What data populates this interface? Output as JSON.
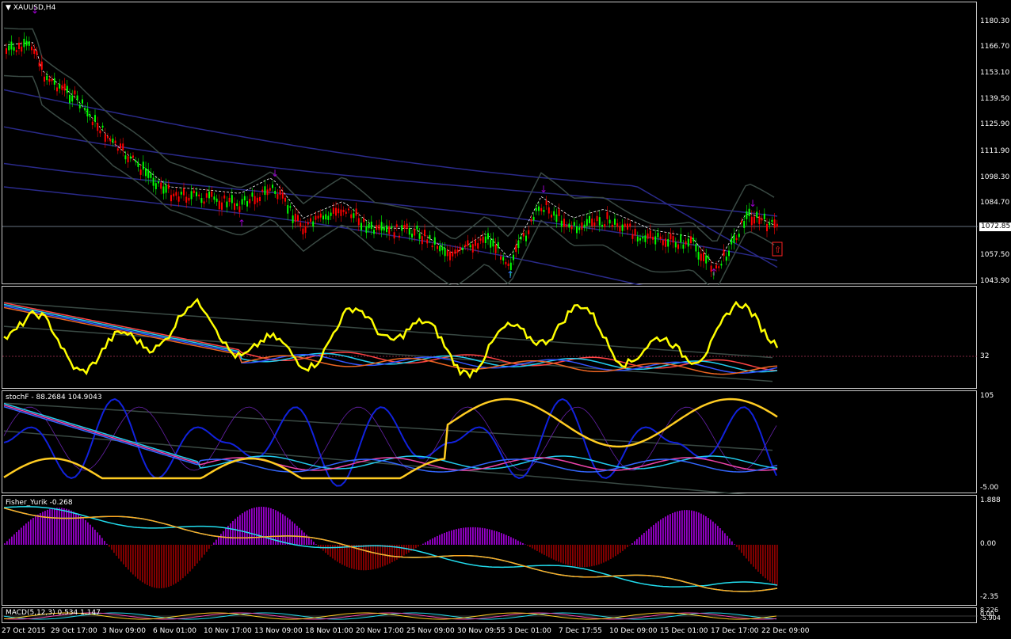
{
  "main_chart": {
    "title": "XAUUSD,H4",
    "price_axis": [
      "1180.30",
      "1166.70",
      "1153.10",
      "1139.50",
      "1125.90",
      "1111.90",
      "1098.30",
      "1084.70",
      "1072.85",
      "1057.50",
      "1043.90"
    ],
    "current_price": "1072.85"
  },
  "rsi_pane": {
    "level_label": "32"
  },
  "stoch_pane": {
    "title": "stochF - 88.2684 104.9043",
    "top_label": "105",
    "bottom_label": "-5.00"
  },
  "fisher_pane": {
    "title": "Fisher_Yurik -0.268",
    "labels": [
      "1.888",
      "0.00",
      "-2.35"
    ]
  },
  "macd_pane": {
    "title": "MACD(5,12,3) 0.534 1.147",
    "labels": [
      "8.226",
      "0.00",
      "-5.904"
    ]
  },
  "time_axis": [
    "27 Oct 2015",
    "29 Oct 17:00",
    "3 Nov 09:00",
    "6 Nov 01:00",
    "10 Nov 17:00",
    "13 Nov 09:00",
    "18 Nov 01:00",
    "20 Nov 17:00",
    "25 Nov 09:00",
    "30 Nov 09:55",
    "3 Dec 01:00",
    "7 Dec 17:55",
    "10 Dec 09:00",
    "15 Dec 01:00",
    "17 Dec 17:00",
    "22 Dec 09:00"
  ],
  "colors": {
    "bull": "#00ff00",
    "bear": "#ff0000",
    "band": "#2a2a8a",
    "bb": "#3a4a44",
    "yellow": "#ffff00",
    "cyan": "#22ddee",
    "magenta": "#ee44aa",
    "purple": "#9900cc",
    "darkred": "#8a0000"
  },
  "icons": [
    "dropdown-triangle-icon",
    "arrow-down-icon",
    "arrow-up-icon",
    "alert-up-arrow-icon"
  ]
}
